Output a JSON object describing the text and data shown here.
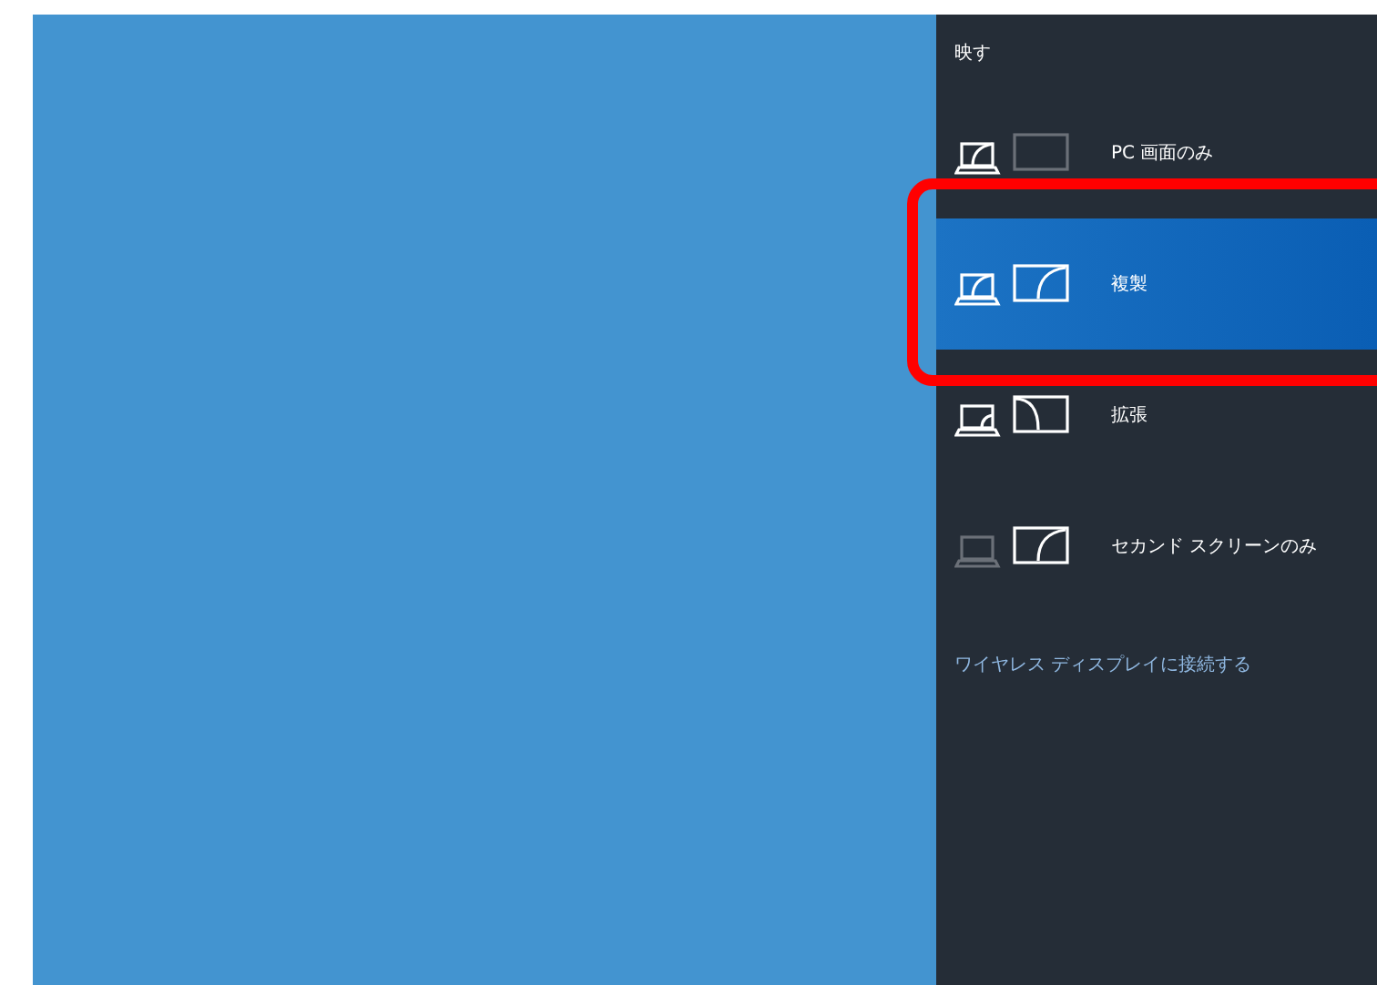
{
  "panel": {
    "title": "映す",
    "items": [
      {
        "kind": "pc-only",
        "label": "PC 画面のみ",
        "selected": false,
        "highlighted": false
      },
      {
        "kind": "duplicate",
        "label": "複製",
        "selected": true,
        "highlighted": true
      },
      {
        "kind": "extend",
        "label": "拡張",
        "selected": false,
        "highlighted": false
      },
      {
        "kind": "second-only",
        "label": "セカンド スクリーンのみ",
        "selected": false,
        "highlighted": false
      }
    ],
    "link": "ワイヤレス ディスプレイに接続する"
  }
}
